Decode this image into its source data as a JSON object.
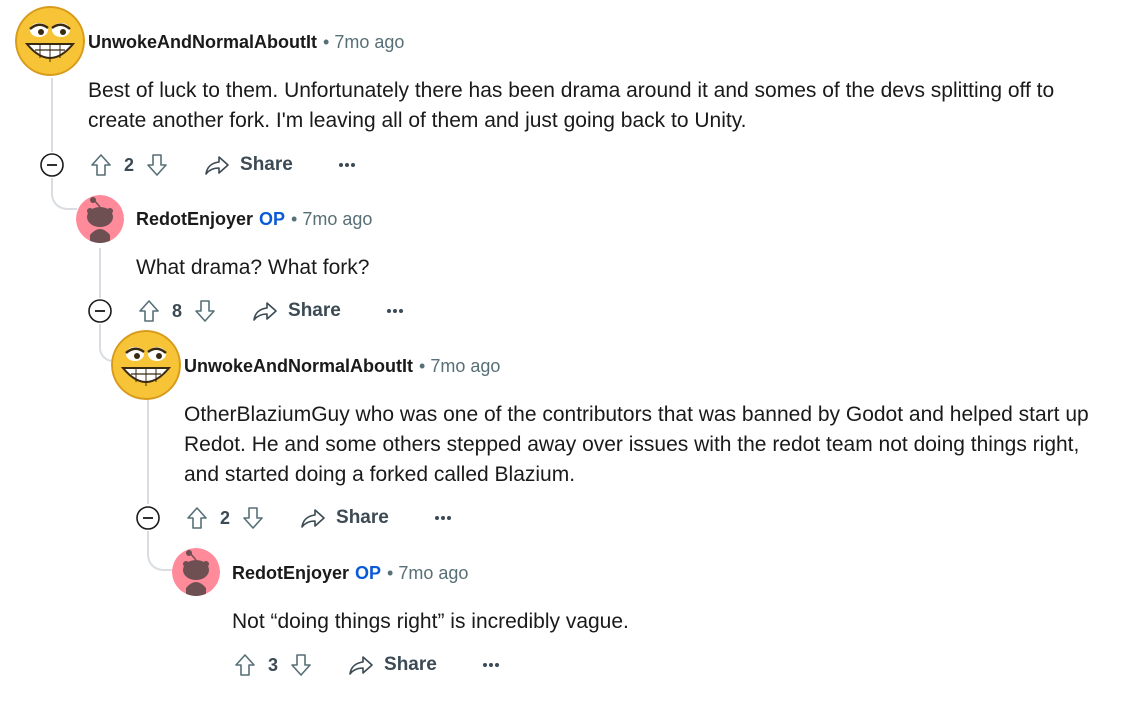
{
  "comments": [
    {
      "username": "UnwokeAndNormalAboutIt",
      "op": "",
      "separator": "•",
      "time": "7mo ago",
      "body": [
        "Best of luck to them. Unfortunately there has been drama around it and somes of the devs splitting off to",
        "create another fork. I'm leaving all of them and just going back to Unity."
      ],
      "score": "2",
      "share_label": "Share",
      "avatar": "emoji-grin-avatar"
    },
    {
      "username": "RedotEnjoyer",
      "op": "OP",
      "separator": "•",
      "time": "7mo ago",
      "body": [
        "What drama? What fork?"
      ],
      "score": "8",
      "share_label": "Share",
      "avatar": "snoo-avatar"
    },
    {
      "username": "UnwokeAndNormalAboutIt",
      "op": "",
      "separator": "•",
      "time": "7mo ago",
      "body": [
        "OtherBlaziumGuy who was one of the contributors that was banned by Godot and helped start up",
        "Redot. He and some others stepped away over issues with the redot team not doing things right,",
        "and started doing a forked called Blazium."
      ],
      "score": "2",
      "share_label": "Share",
      "avatar": "emoji-grin-avatar"
    },
    {
      "username": "RedotEnjoyer",
      "op": "OP",
      "separator": "•",
      "time": "7mo ago",
      "body": [
        "Not “doing things right” is incredibly vague."
      ],
      "score": "3",
      "share_label": "Share",
      "avatar": "snoo-avatar"
    }
  ],
  "colors": {
    "op": "#0a5ad6",
    "meta": "#576f76",
    "thread_line": "#d9dde1",
    "snoo_bg": "#ff8a9a"
  },
  "icons": [
    "collapse-icon",
    "upvote-icon",
    "downvote-icon",
    "share-icon",
    "more-icon"
  ]
}
